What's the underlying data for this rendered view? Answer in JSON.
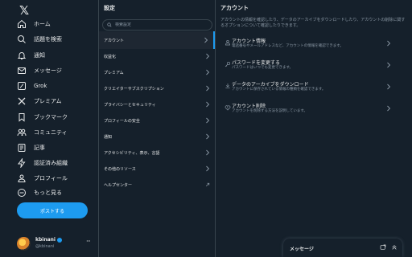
{
  "nav": {
    "items": [
      {
        "label": "ホーム",
        "icon": "home-icon"
      },
      {
        "label": "話題を検索",
        "icon": "search-icon"
      },
      {
        "label": "通知",
        "icon": "bell-icon"
      },
      {
        "label": "メッセージ",
        "icon": "mail-icon"
      },
      {
        "label": "Grok",
        "icon": "grok-icon"
      },
      {
        "label": "プレミアム",
        "icon": "x-icon"
      },
      {
        "label": "ブックマーク",
        "icon": "bookmark-icon"
      },
      {
        "label": "コミュニティ",
        "icon": "communities-icon"
      },
      {
        "label": "記事",
        "icon": "article-icon"
      },
      {
        "label": "認証済み組織",
        "icon": "lightning-icon"
      },
      {
        "label": "プロフィール",
        "icon": "profile-icon"
      },
      {
        "label": "もっと見る",
        "icon": "more-circle-icon"
      }
    ],
    "post_button": "ポストする"
  },
  "account": {
    "name": "kbinani",
    "handle": "@kbinani"
  },
  "settings": {
    "title": "設定",
    "search_placeholder": "検索設定",
    "items": [
      {
        "label": "アカウント",
        "active": true,
        "chevron": "chevron-right-icon"
      },
      {
        "label": "収益化",
        "active": false,
        "chevron": "chevron-right-icon"
      },
      {
        "label": "プレミアム",
        "active": false,
        "chevron": "chevron-right-icon"
      },
      {
        "label": "クリエイターサブスクリプション",
        "active": false,
        "chevron": "chevron-right-icon"
      },
      {
        "label": "プライバシーとセキュリティ",
        "active": false,
        "chevron": "chevron-right-icon"
      },
      {
        "label": "プロフィールの安全",
        "active": false,
        "chevron": "chevron-right-icon"
      },
      {
        "label": "通知",
        "active": false,
        "chevron": "chevron-right-icon"
      },
      {
        "label": "アクセシビリティ、表示、言語",
        "active": false,
        "chevron": "chevron-right-icon"
      },
      {
        "label": "その他のリソース",
        "active": false,
        "chevron": "chevron-right-icon"
      },
      {
        "label": "ヘルプセンター",
        "active": false,
        "chevron": "external-link-icon"
      }
    ]
  },
  "detail": {
    "title": "アカウント",
    "description": "アカウントの情報を確認したり、データのアーカイブをダウンロードしたり、アカウントの削除に関するオプションについて確認したりできます。",
    "options": [
      {
        "title": "アカウント情報",
        "subtitle": "電話番号やメールアドレスなど、アカウントの情報を確認できます。",
        "icon": "person-icon"
      },
      {
        "title": "パスワードを変更する",
        "subtitle": "パスワードはいつでも変更できます。",
        "icon": "key-icon"
      },
      {
        "title": "データのアーカイブをダウンロード",
        "subtitle": "アカウントに保存されている情報の種類を確認できます。",
        "icon": "download-icon"
      },
      {
        "title": "アカウント削除",
        "subtitle": "アカウントを削除する方法を説明しています。",
        "icon": "heart-broken-icon"
      }
    ]
  },
  "messages_drawer": {
    "title": "メッセージ"
  },
  "colors": {
    "background": "#15202b",
    "accent": "#1d9bf0",
    "border": "#38444d",
    "secondary_text": "#8b98a5"
  }
}
